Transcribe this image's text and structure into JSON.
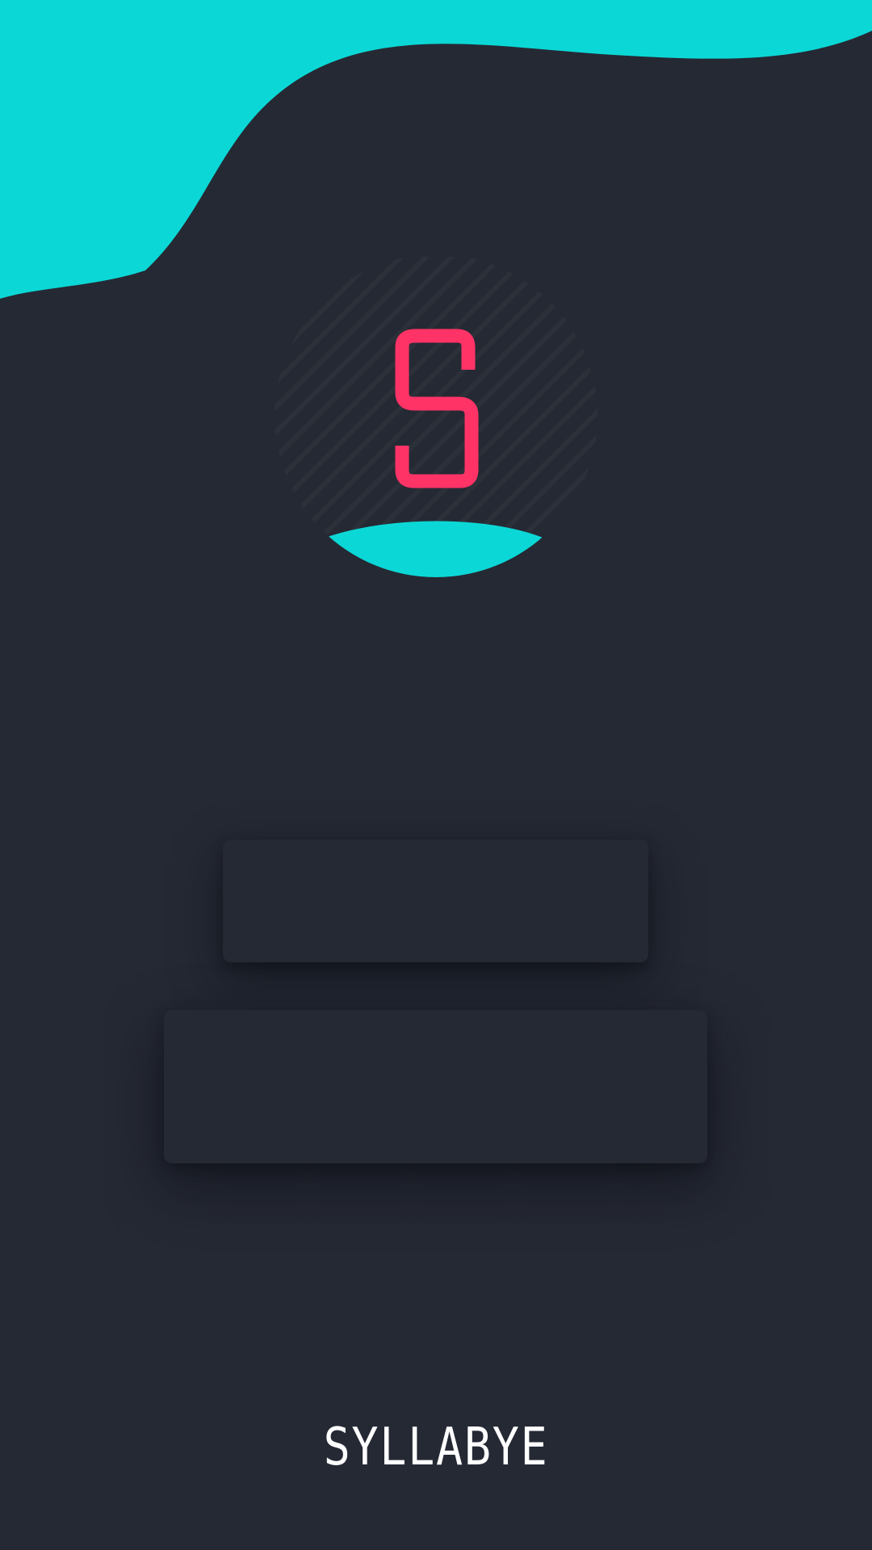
{
  "app": {
    "brand_name": "SYLLABYE"
  },
  "logo": {
    "letter": "S",
    "letter_icon": "s-logo-icon"
  },
  "cards": [
    {
      "name": "card-top",
      "label": ""
    },
    {
      "name": "card-bottom",
      "label": ""
    }
  ],
  "colors": {
    "background": "#252934",
    "accent_teal": "#0bd8d6",
    "logo_red": "#ff3366",
    "stripe": "#2c3039",
    "text": "#ffffff"
  }
}
